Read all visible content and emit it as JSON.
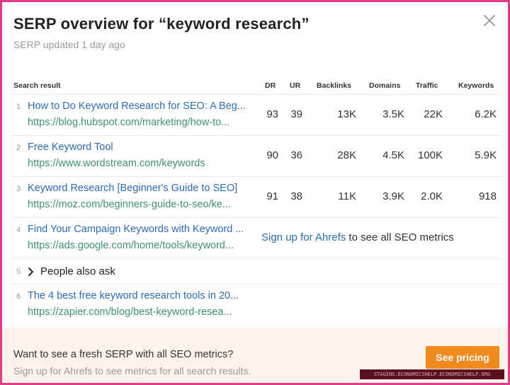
{
  "modal": {
    "title": "SERP overview for “keyword research”",
    "subtitle": "SERP updated 1 day ago",
    "close_icon": "close-icon"
  },
  "table": {
    "headers": {
      "search_result": "Search result",
      "dr": "DR",
      "ur": "UR",
      "backlinks": "Backlinks",
      "domains": "Domains",
      "traffic": "Traffic",
      "keywords": "Keywords"
    },
    "rows": [
      {
        "rank": "1",
        "title": "How to Do Keyword Research for SEO: A Beg...",
        "url": "https://blog.hubspot.com/marketing/how-to...",
        "dr": "93",
        "ur": "39",
        "backlinks": "13K",
        "domains": "3.5K",
        "traffic": "22K",
        "keywords": "6.2K"
      },
      {
        "rank": "2",
        "title": "Free Keyword Tool",
        "url": "https://www.wordstream.com/keywords",
        "dr": "90",
        "ur": "36",
        "backlinks": "28K",
        "domains": "4.5K",
        "traffic": "100K",
        "keywords": "5.9K"
      },
      {
        "rank": "3",
        "title": "Keyword Research [Beginner's Guide to SEO]",
        "url": "https://moz.com/beginners-guide-to-seo/ke...",
        "dr": "91",
        "ur": "38",
        "backlinks": "11K",
        "domains": "3.9K",
        "traffic": "2.0K",
        "keywords": "918"
      },
      {
        "rank": "4",
        "title": "Find Your Campaign Keywords with Keyword ...",
        "url": "https://ads.google.com/home/tools/keyword...",
        "signup_link": "Sign up for Ahrefs",
        "signup_rest": " to see all SEO metrics"
      },
      {
        "rank": "5",
        "people_also_ask": "People also ask"
      },
      {
        "rank": "6",
        "title": "The 4 best free keyword research tools in 20...",
        "url": "https://zapier.com/blog/best-keyword-resea..."
      }
    ]
  },
  "footer": {
    "line1": "Want to see a fresh SERP with all SEO metrics?",
    "line2": "Sign up for Ahrefs to see metrics for all search results.",
    "button": "See pricing",
    "button_color": "#f08a1c",
    "background": "#fdf3ea"
  },
  "watermark": "STAGING.ECONOMICSHELP.ECONOMICSHELP.ORG",
  "colors": {
    "frame_border": "#e23a86",
    "link_title": "#2d6bb5",
    "link_url": "#3f8f7a"
  }
}
